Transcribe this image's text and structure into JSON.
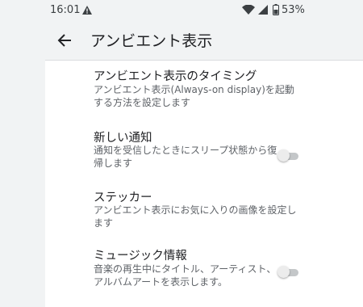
{
  "status_bar": {
    "time": "16:01",
    "battery": "53%",
    "icons": [
      "warning-icon",
      "wifi-icon",
      "signal-icon",
      "battery-icon"
    ]
  },
  "app_bar": {
    "back_icon": "arrow-back-icon",
    "title": "アンビエント表示"
  },
  "settings": {
    "timing": {
      "title": "アンビエント表示のタイミング",
      "summary": "アンビエント表示(Always-on display)を起動する方法を設定します"
    },
    "new_notifications": {
      "title": "新しい通知",
      "summary": "通知を受信したときにスリープ状態から復帰します",
      "toggle_state": "off"
    },
    "sticker": {
      "title": "ステッカー",
      "summary": "アンビエント表示にお気に入りの画像を設定します"
    },
    "music_info": {
      "title": "ミュージック情報",
      "summary": "音楽の再生中にタイトル、アーティスト、アルバムアートを表示します。",
      "toggle_state": "off"
    }
  },
  "colors": {
    "background": "#f1f3f4",
    "surface": "#ffffff",
    "primary_text": "#202124",
    "secondary_text": "#5f6368",
    "toggle_off_track": "#c4c7c9",
    "toggle_off_thumb": "#ececec"
  }
}
